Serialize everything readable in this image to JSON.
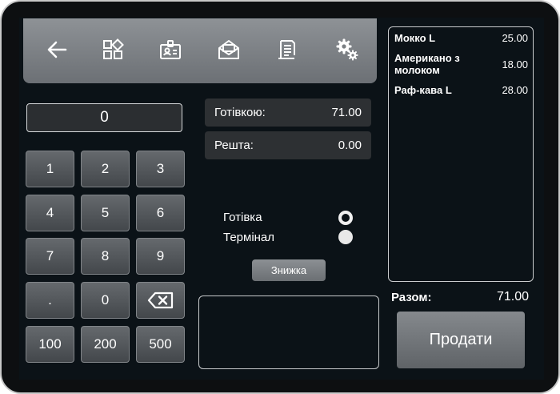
{
  "toolbar": {
    "icons": [
      "back-arrow-icon",
      "categories-grid-icon",
      "employee-badge-icon",
      "mail-icon",
      "receipt-icon",
      "settings-gears-icon"
    ]
  },
  "keypad": {
    "display": "0",
    "keys": [
      "1",
      "2",
      "3",
      "4",
      "5",
      "6",
      "7",
      "8",
      "9",
      ".",
      "0",
      "backspace-icon",
      "100",
      "200",
      "500"
    ]
  },
  "payment": {
    "cash_label": "Готівкою:",
    "cash_value": "71.00",
    "change_label": "Решта:",
    "change_value": "0.00",
    "methods": [
      {
        "label": "Готівка",
        "selected": true
      },
      {
        "label": "Термінал",
        "selected": false
      }
    ],
    "discount_label": "Знижка"
  },
  "order": {
    "items": [
      {
        "name": "Мокко L",
        "price": "25.00"
      },
      {
        "name": "Американо з молоком",
        "price": "18.00"
      },
      {
        "name": "Раф-кава L",
        "price": "28.00"
      }
    ],
    "total_label": "Разом:",
    "total_value": "71.00",
    "sell_label": "Продати"
  }
}
